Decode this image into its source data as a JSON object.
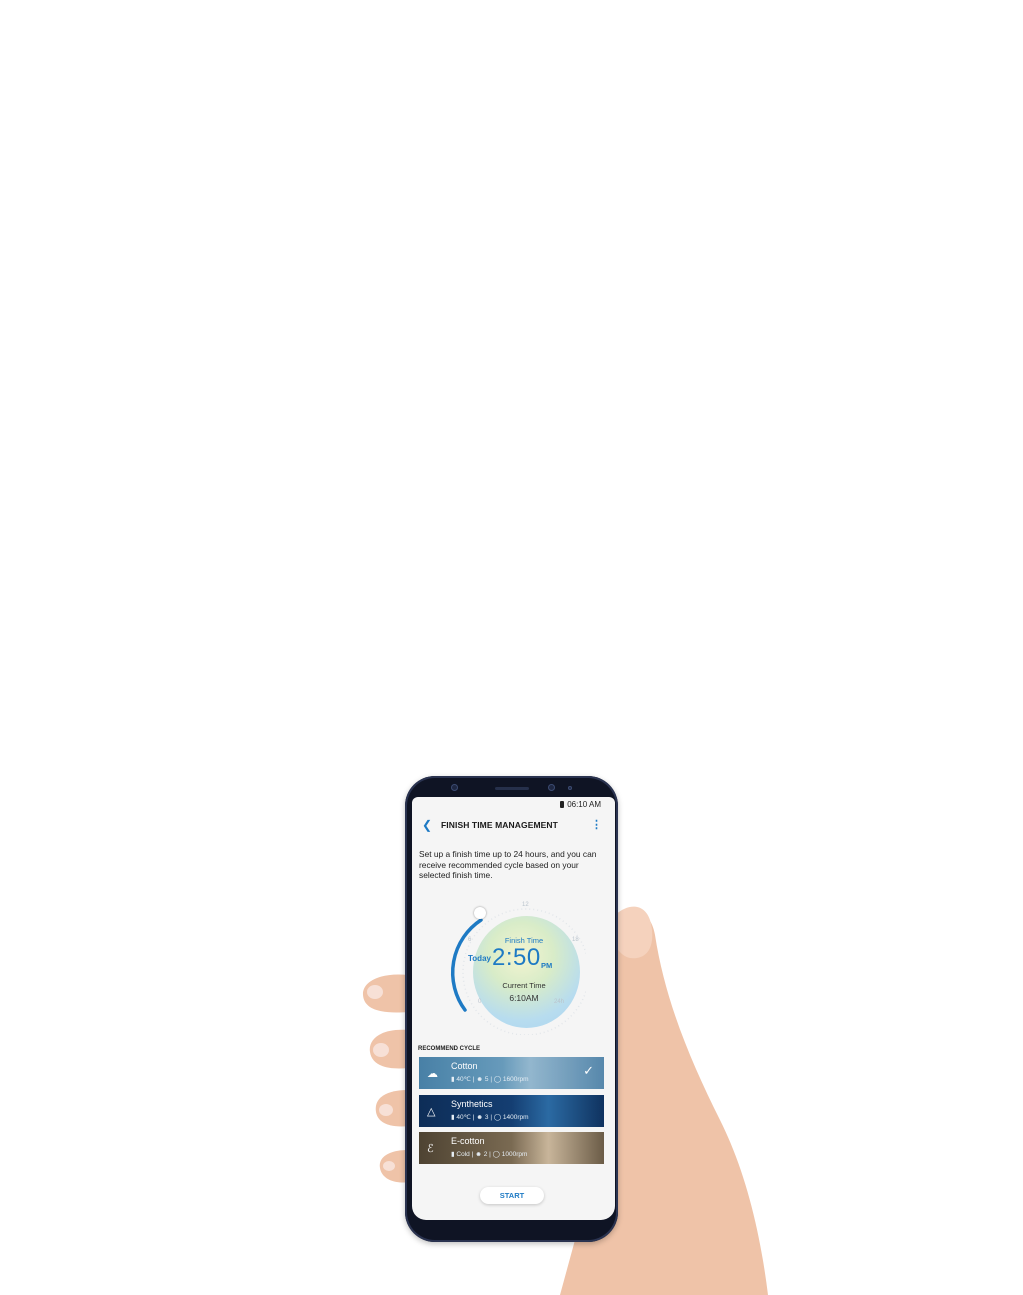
{
  "status_bar": {
    "time": "06:10 AM"
  },
  "appbar": {
    "title": "FINISH TIME MANAGEMENT"
  },
  "description": "Set up a finish time up to 24 hours, and you can receive recommended cycle based on your selected finish time.",
  "dial": {
    "finish_label": "Finish Time",
    "day": "Today",
    "time": "2:50",
    "meridiem": "PM",
    "current_label": "Current Time",
    "current_time": "6:10AM",
    "ticks": {
      "top": "12",
      "left": "6",
      "right": "18",
      "bottom_left": "0",
      "bottom_right": "24h"
    }
  },
  "recommend": {
    "title": "RECOMMEND CYCLE",
    "cycles": [
      {
        "name": "Cotton",
        "temp": "40℃",
        "rinse": "5",
        "spin": "1600rpm",
        "icon": "cotton-icon"
      },
      {
        "name": "Synthetics",
        "temp": "40℃",
        "rinse": "3",
        "spin": "1400rpm",
        "icon": "synthetics-icon"
      },
      {
        "name": "E-cotton",
        "temp": "Cold",
        "rinse": "2",
        "spin": "1000rpm",
        "icon": "ecotton-icon"
      }
    ]
  },
  "start_label": "START",
  "colors": {
    "accent": "#1e7ac4",
    "phone_body": "#0f1424"
  }
}
